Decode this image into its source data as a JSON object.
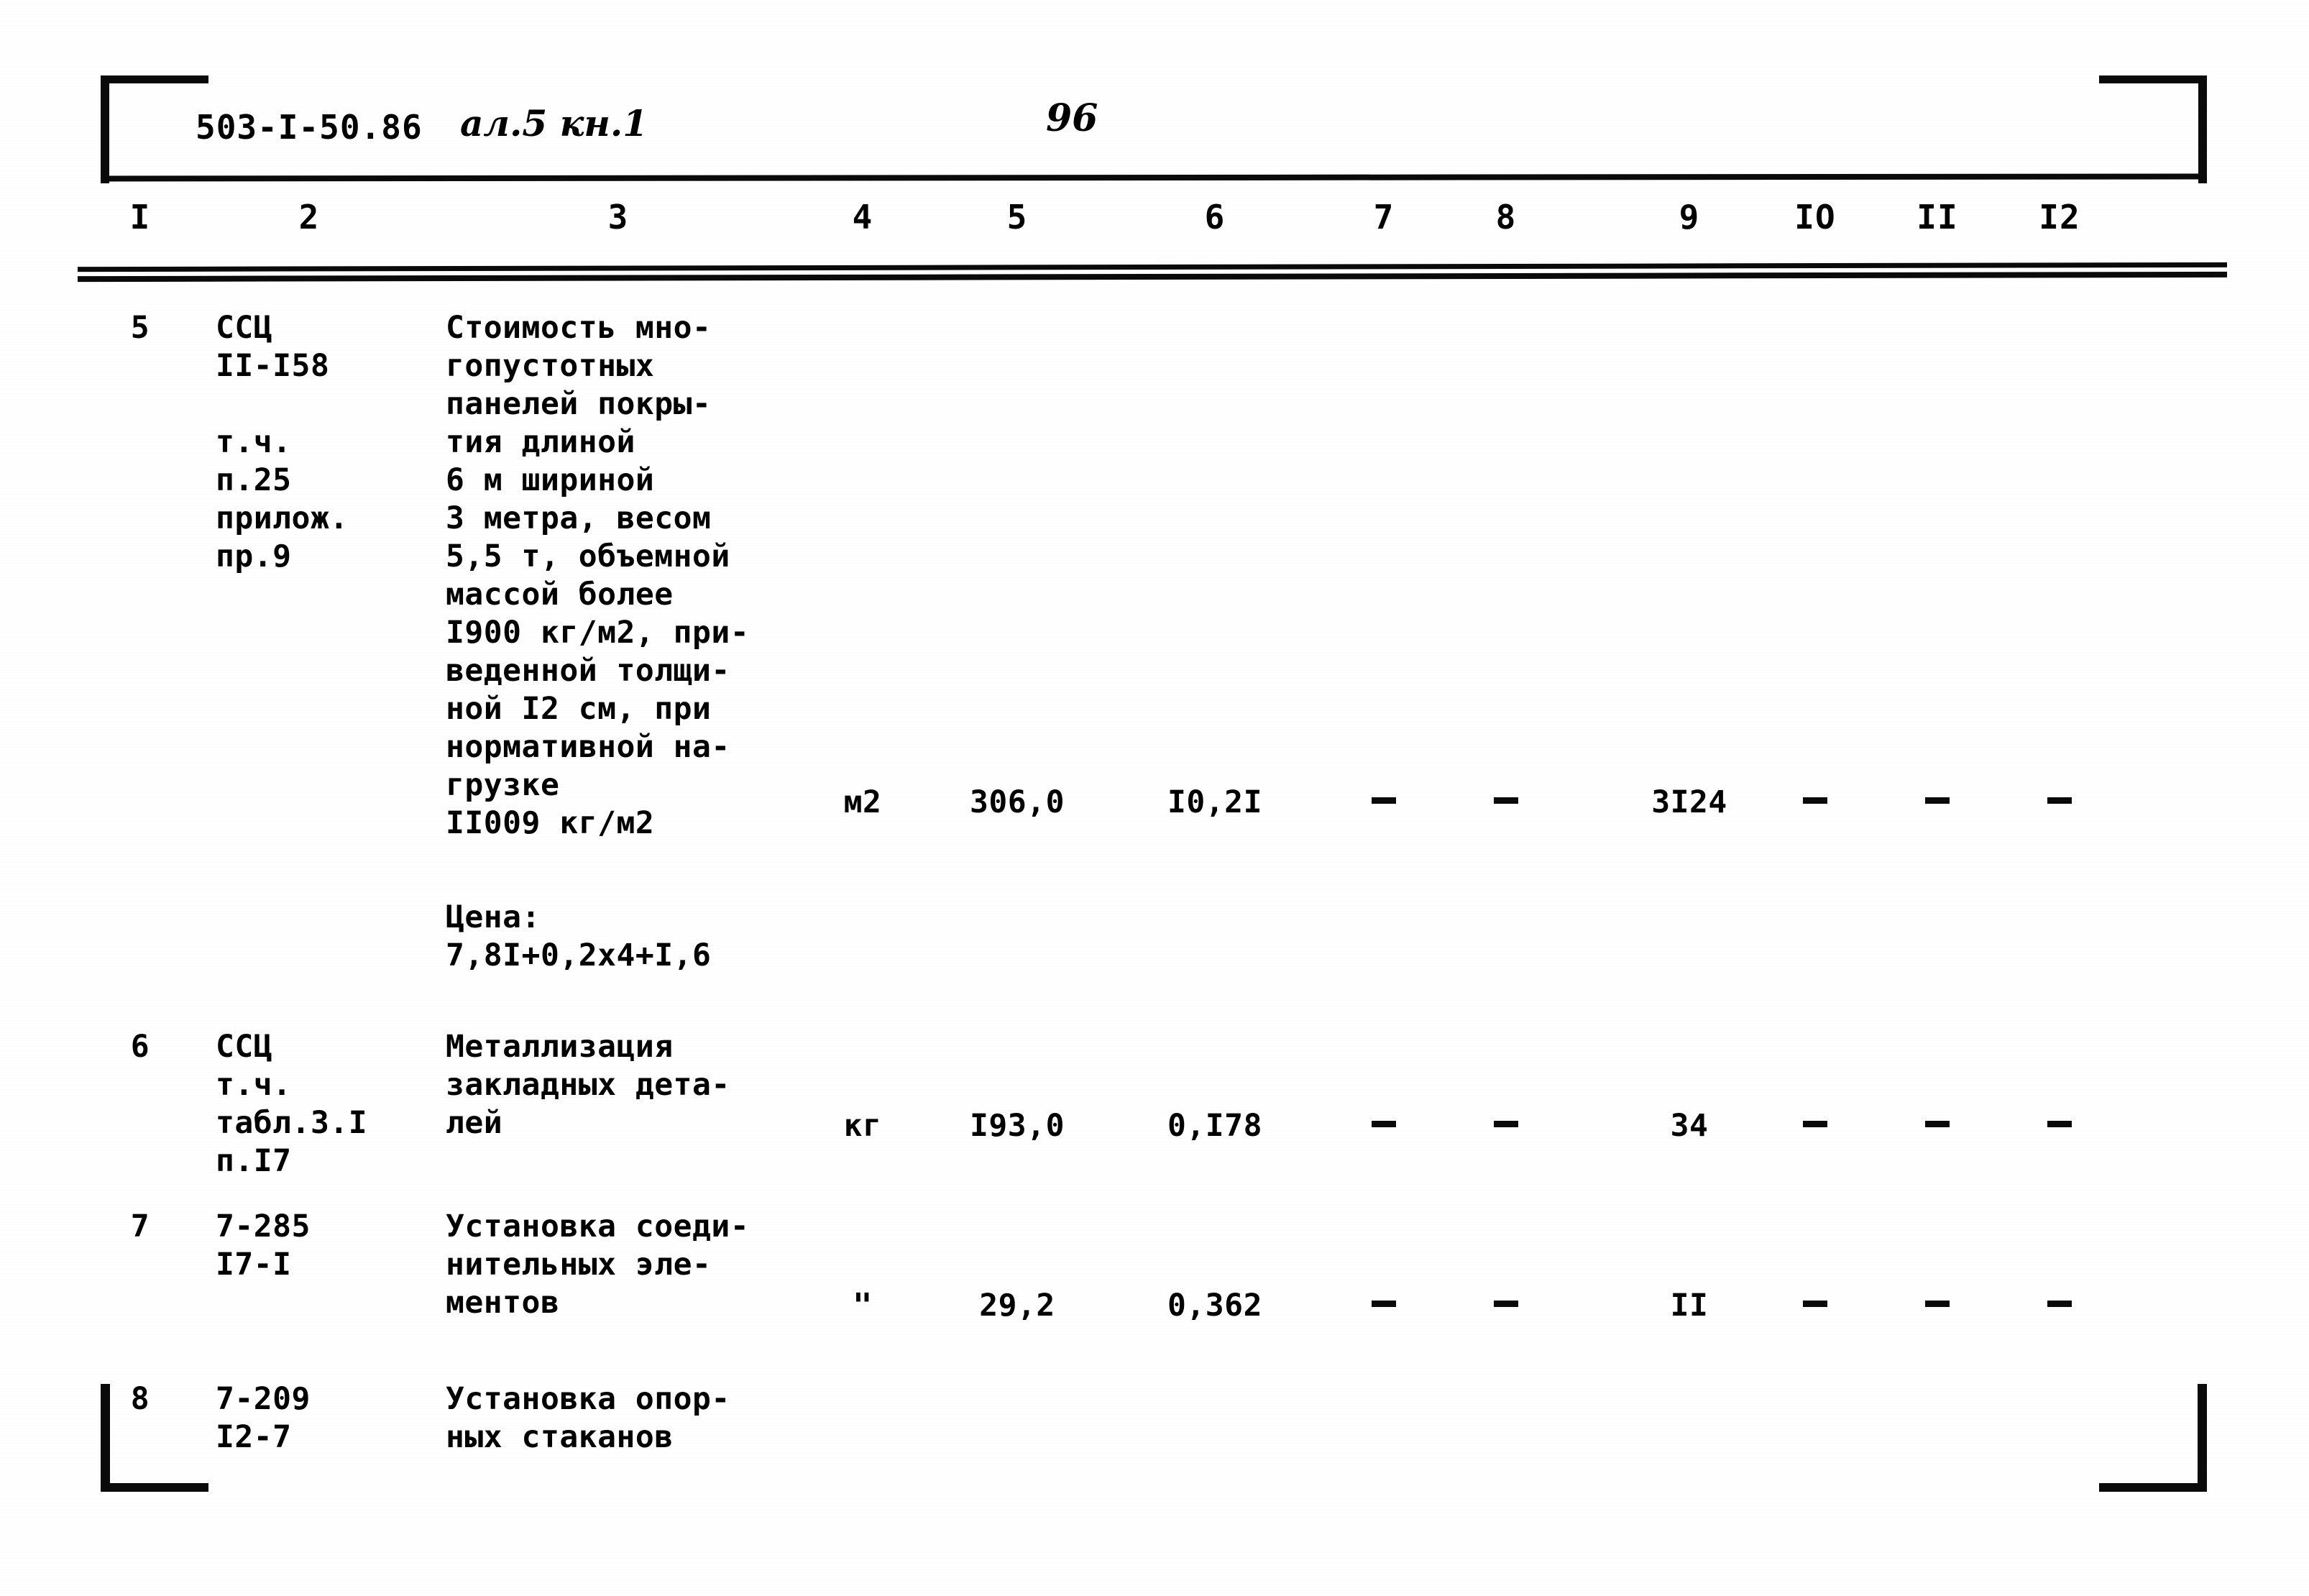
{
  "document": {
    "code": "503-I-50.86",
    "album": "ал.5 кн.1",
    "page_number": "96"
  },
  "table": {
    "column_headers": [
      "I",
      "2",
      "3",
      "4",
      "5",
      "6",
      "7",
      "8",
      "9",
      "IO",
      "II",
      "I2"
    ],
    "rows": [
      {
        "num": "5",
        "code": "ССЦ\nII-I58\n\nт.ч.\nп.25\nприлож.\nпр.9",
        "description": "Стоимость мно-\nгопустотных\nпанелей покры-\nтия длиной\n6 м шириной\n3 метра, весом\n5,5 т, объемной\nмассой более\nI900 кг/м2, при-\nведенной толщи-\nной I2 см, при\nнормативной на-\nгрузке\nII009 кг/м2",
        "unit": "м2",
        "col5": "306,0",
        "col6": "I0,2I",
        "col7": "-",
        "col8": "-",
        "col9": "3I24",
        "col10": "-",
        "col11": "-",
        "col12": "-",
        "note": "Цена:\n7,8I+0,2x4+I,6"
      },
      {
        "num": "6",
        "code": "ССЦ\nт.ч.\nтабл.3.I\nп.I7",
        "description": "Металлизация\nзакладных дета-\nлей",
        "unit": "кг",
        "col5": "I93,0",
        "col6": "0,I78",
        "col7": "-",
        "col8": "-",
        "col9": "34",
        "col10": "-",
        "col11": "-",
        "col12": "-",
        "note": ""
      },
      {
        "num": "7",
        "code": "7-285\nI7-I",
        "description": "Установка соеди-\nнительных эле-\nментов",
        "unit": "\"",
        "col5": "29,2",
        "col6": "0,362",
        "col7": "-",
        "col8": "-",
        "col9": "II",
        "col10": "-",
        "col11": "-",
        "col12": "-",
        "note": ""
      },
      {
        "num": "8",
        "code": "7-209\nI2-7",
        "description": "Установка опор-\nных стаканов",
        "unit": "",
        "col5": "",
        "col6": "",
        "col7": "",
        "col8": "",
        "col9": "",
        "col10": "",
        "col11": "",
        "col12": "",
        "note": ""
      }
    ]
  }
}
